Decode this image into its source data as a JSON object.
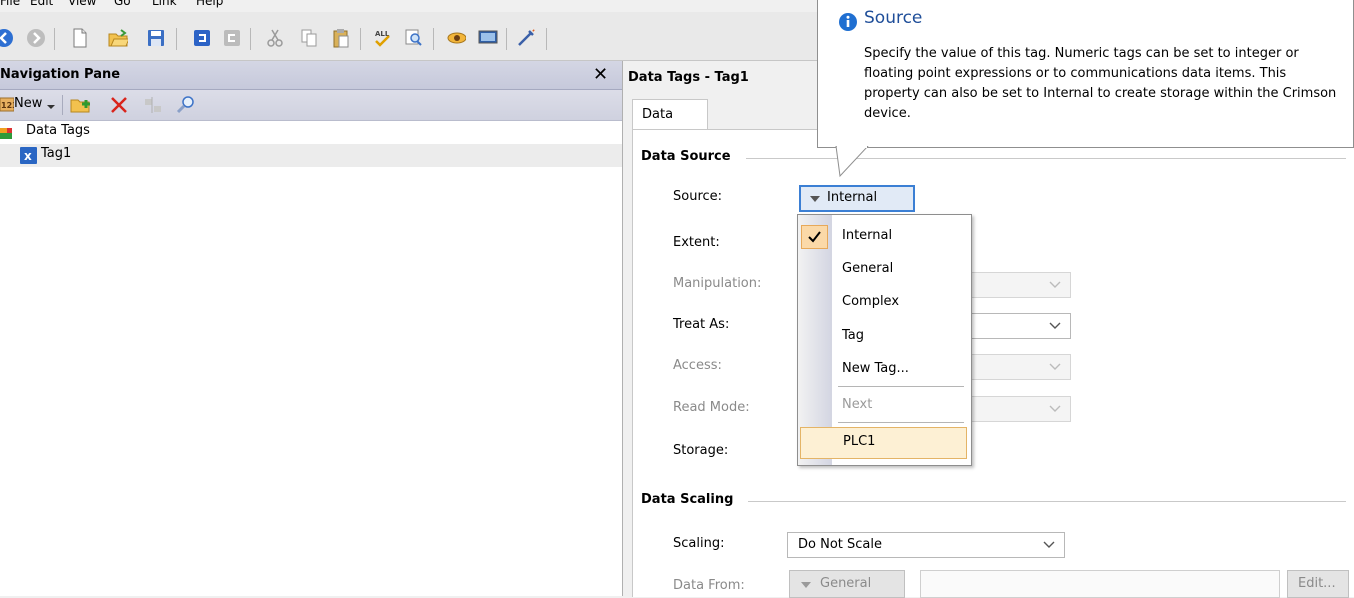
{
  "menu": [
    "File",
    "Edit",
    "View",
    "Go",
    "Link",
    "Help"
  ],
  "nav": {
    "title": "Navigation Pane",
    "new_label": "New",
    "tree": [
      {
        "label": "Data Tags"
      },
      {
        "label": "Tag1"
      }
    ]
  },
  "right": {
    "title": "Data Tags - Tag1",
    "tab": "Data",
    "data_source": {
      "header": "Data Source",
      "source_label": "Source:",
      "source_value": "Internal",
      "extent_label": "Extent:",
      "manipulation_label": "Manipulation:",
      "treat_as_label": "Treat As:",
      "access_label": "Access:",
      "read_mode_label": "Read Mode:",
      "storage_label": "Storage:"
    },
    "data_scaling": {
      "header": "Data Scaling",
      "scaling_label": "Scaling:",
      "scaling_value": "Do Not Scale",
      "data_from_label": "Data From:",
      "data_from_value": "General",
      "edit_label": "Edit..."
    }
  },
  "dropdown": {
    "items": [
      "Internal",
      "General",
      "Complex",
      "Tag",
      "New Tag...",
      "Next",
      "PLC1"
    ]
  },
  "tooltip": {
    "title": "Source",
    "body": "Specify the value of this tag. Numeric tags can be set to integer or floating point expressions or to communications data items. This property can also be set to Internal to create storage within the Crimson device."
  },
  "colors": {
    "info_blue": "#1f6fd1",
    "delete_red": "#d9241c",
    "selection_border": "#3b7fd4",
    "plc_highlight": "#fdf0d4"
  }
}
